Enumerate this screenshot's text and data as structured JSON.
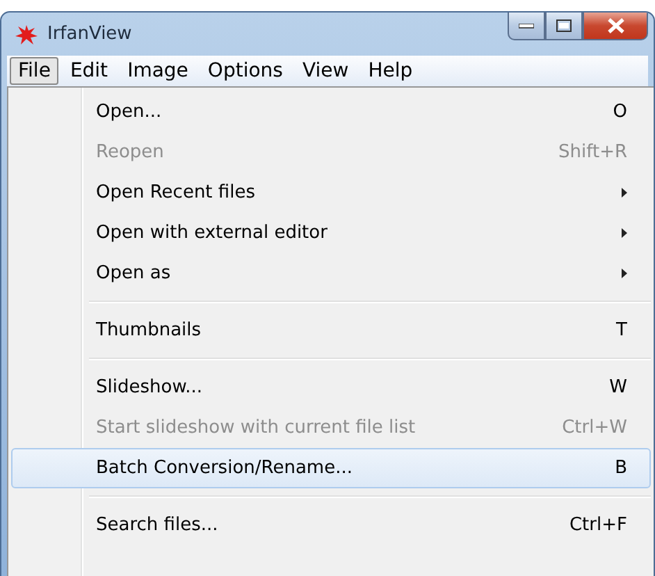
{
  "window": {
    "title": "IrfanView"
  },
  "menubar": [
    {
      "label": "File",
      "selected": true
    },
    {
      "label": "Edit",
      "selected": false
    },
    {
      "label": "Image",
      "selected": false
    },
    {
      "label": "Options",
      "selected": false
    },
    {
      "label": "View",
      "selected": false
    },
    {
      "label": "Help",
      "selected": false
    }
  ],
  "menu": [
    {
      "kind": "item",
      "label": "Open...",
      "shortcut": "O",
      "submenu": false,
      "disabled": false,
      "selected": false
    },
    {
      "kind": "item",
      "label": "Reopen",
      "shortcut": "Shift+R",
      "submenu": false,
      "disabled": true,
      "selected": false
    },
    {
      "kind": "item",
      "label": "Open Recent files",
      "submenu": true,
      "disabled": false,
      "selected": false
    },
    {
      "kind": "item",
      "label": "Open with external editor",
      "submenu": true,
      "disabled": false,
      "selected": false
    },
    {
      "kind": "item",
      "label": "Open as",
      "submenu": true,
      "disabled": false,
      "selected": false
    },
    {
      "kind": "separator"
    },
    {
      "kind": "item",
      "label": "Thumbnails",
      "shortcut": "T",
      "submenu": false,
      "disabled": false,
      "selected": false
    },
    {
      "kind": "separator"
    },
    {
      "kind": "item",
      "label": "Slideshow...",
      "shortcut": "W",
      "submenu": false,
      "disabled": false,
      "selected": false
    },
    {
      "kind": "item",
      "label": "Start slideshow with current file list",
      "shortcut": "Ctrl+W",
      "submenu": false,
      "disabled": true,
      "selected": false
    },
    {
      "kind": "item",
      "label": "Batch Conversion/Rename...",
      "shortcut": "B",
      "submenu": false,
      "disabled": false,
      "selected": true
    },
    {
      "kind": "separator"
    },
    {
      "kind": "item",
      "label": "Search files...",
      "shortcut": "Ctrl+F",
      "submenu": false,
      "disabled": false,
      "selected": false
    }
  ]
}
